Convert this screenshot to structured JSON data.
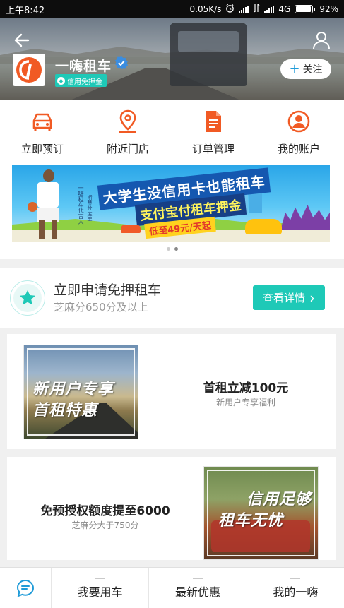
{
  "status_bar": {
    "time": "上午8:42",
    "speed": "0.05K/s",
    "network": "4G",
    "battery": "92%",
    "battery_level": 0.92
  },
  "header": {
    "brand_name": "一嗨租车",
    "badge": "信用免押金",
    "follow_label": "关注",
    "follow_plus": "+"
  },
  "actions": [
    {
      "label": "立即预订",
      "icon": "car-icon"
    },
    {
      "label": "附近门店",
      "icon": "location-pin-icon"
    },
    {
      "label": "订单管理",
      "icon": "document-icon"
    },
    {
      "label": "我的账户",
      "icon": "account-icon"
    }
  ],
  "banner": {
    "headline": "大学生没信用卡也能租车",
    "subline": "支付宝付租车押金",
    "price": "低至49元/天起",
    "side_text": "一嗨租车代言人",
    "side_text2": "斯蒂芬·库里",
    "page_count": 2,
    "active_page": 2
  },
  "colors": {
    "accent": "#1ec9b7",
    "icon_orange": "#f15a24",
    "verified_blue": "#3b8de0"
  },
  "promo": {
    "title": "立即申请免押租车",
    "subtitle": "芝麻分650分及以上",
    "button": "查看详情",
    "button_arrow": "›"
  },
  "cards": [
    {
      "image_caption_1": "新用户专享",
      "image_caption_2": "首租特惠",
      "title": "首租立减100元",
      "subtitle": "新用户专享福利"
    },
    {
      "image_caption_1": "信用足够",
      "image_caption_2": "租车无忧",
      "title": "免预授权额度提至6000",
      "subtitle": "芝麻分大于750分"
    }
  ],
  "bottom_nav": {
    "chat_icon": "chat-bubble-icon",
    "tabs": [
      "我要用车",
      "最新优惠",
      "我的一嗨"
    ]
  }
}
